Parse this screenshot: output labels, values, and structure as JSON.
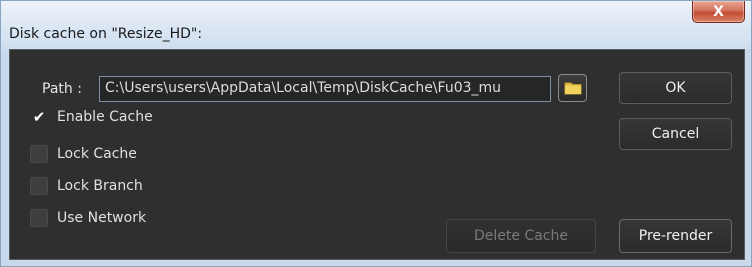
{
  "window": {
    "title": "Disk cache on \"Resize_HD\":",
    "close_glyph": "X"
  },
  "path": {
    "label": "Path :",
    "value": "C:\\Users\\users\\AppData\\Local\\Temp\\DiskCache\\Fu03_mu"
  },
  "options": [
    {
      "label": "Enable Cache",
      "checked": true
    },
    {
      "label": "Lock Cache",
      "checked": false
    },
    {
      "label": "Lock Branch",
      "checked": false
    },
    {
      "label": "Use Network",
      "checked": false
    }
  ],
  "buttons": {
    "ok": "OK",
    "cancel": "Cancel",
    "delete_cache": "Delete Cache",
    "pre_render": "Pre-render"
  },
  "check_glyph": "✔",
  "icons": {
    "folder": "folder-icon",
    "close": "close-icon",
    "check": "checkmark-icon"
  },
  "colors": {
    "panel_bg": "#2f2f2f",
    "folder_yellow": "#e8c54a",
    "close_red": "#c24c33"
  }
}
